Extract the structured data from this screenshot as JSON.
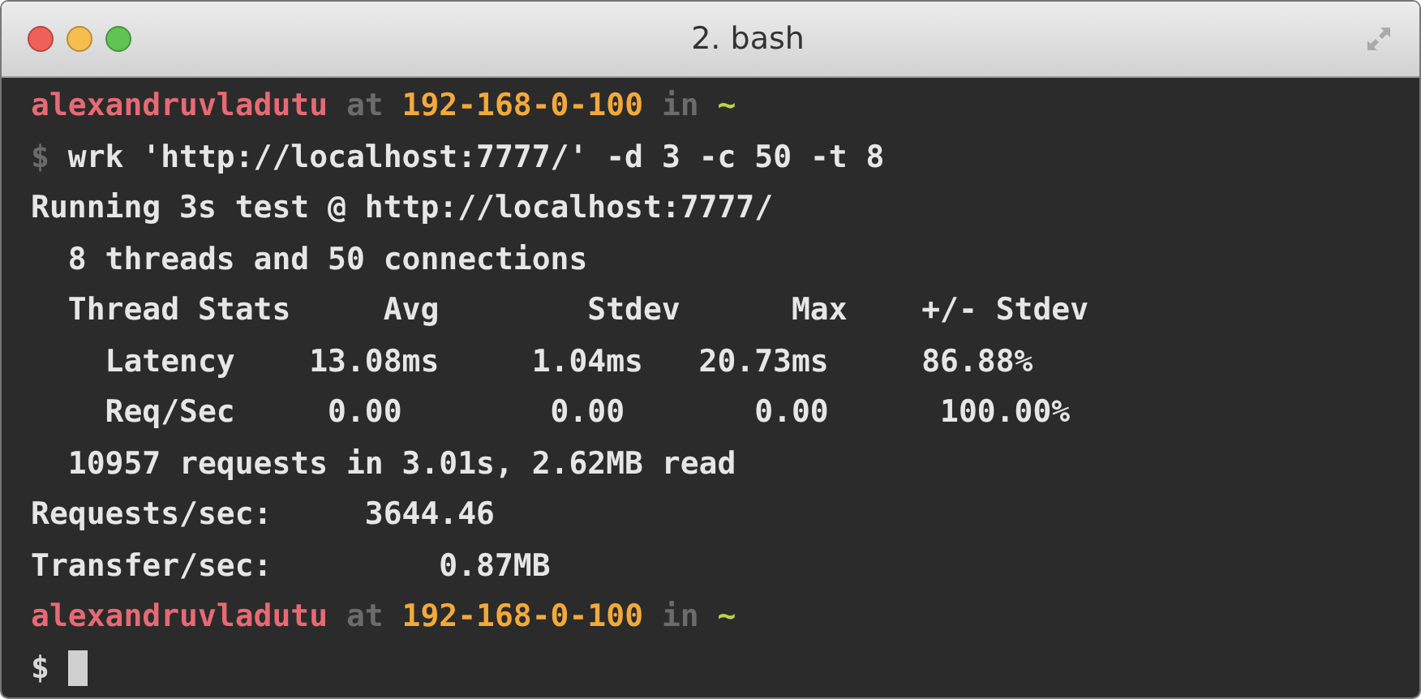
{
  "window": {
    "title": "2. bash"
  },
  "lines": [
    {
      "segments": [
        {
          "kind": "user",
          "text": "alexandruvladutu"
        },
        {
          "kind": "dim",
          "text": " at "
        },
        {
          "kind": "host",
          "text": "192-168-0-100"
        },
        {
          "kind": "dim",
          "text": " in "
        },
        {
          "kind": "dir",
          "text": "~"
        }
      ]
    },
    {
      "segments": [
        {
          "kind": "dim",
          "text": "$"
        },
        {
          "kind": "output",
          "text": " wrk 'http://localhost:7777/' -d 3 -c 50 -t 8"
        }
      ]
    },
    {
      "segments": [
        {
          "kind": "output",
          "text": "Running 3s test @ http://localhost:7777/"
        }
      ]
    },
    {
      "segments": [
        {
          "kind": "output",
          "text": "  8 threads and 50 connections"
        }
      ]
    },
    {
      "segments": [
        {
          "kind": "output",
          "text": "  Thread Stats     Avg        Stdev      Max    +/- Stdev"
        }
      ]
    },
    {
      "segments": [
        {
          "kind": "output",
          "text": "    Latency    13.08ms     1.04ms   20.73ms     86.88%"
        }
      ]
    },
    {
      "segments": [
        {
          "kind": "output",
          "text": "    Req/Sec     0.00        0.00       0.00      100.00%"
        }
      ]
    },
    {
      "segments": [
        {
          "kind": "output",
          "text": "  10957 requests in 3.01s, 2.62MB read"
        }
      ]
    },
    {
      "segments": [
        {
          "kind": "output",
          "text": "Requests/sec:     3644.46"
        }
      ]
    },
    {
      "segments": [
        {
          "kind": "output",
          "text": "Transfer/sec:         0.87MB"
        }
      ]
    },
    {
      "segments": [
        {
          "kind": "user",
          "text": "alexandruvladutu"
        },
        {
          "kind": "dim",
          "text": " at "
        },
        {
          "kind": "host",
          "text": "192-168-0-100"
        },
        {
          "kind": "dim",
          "text": " in "
        },
        {
          "kind": "dir",
          "text": "~"
        }
      ]
    },
    {
      "segments": [
        {
          "kind": "prompt",
          "text": "$"
        },
        {
          "kind": "cursor"
        }
      ]
    }
  ]
}
